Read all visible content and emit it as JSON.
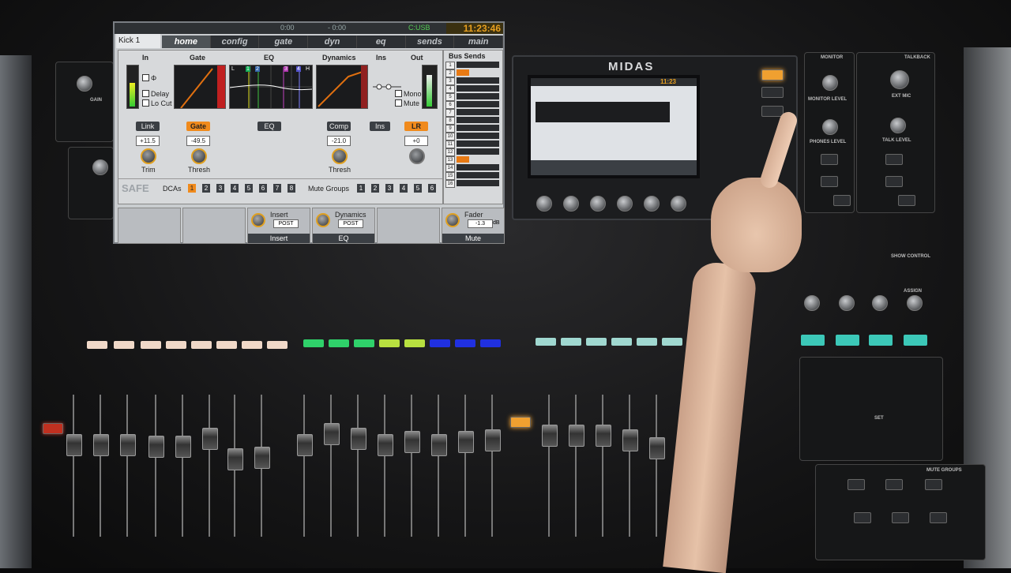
{
  "app": {
    "channel_name": "Kick 1",
    "time_elapsed": "0:00",
    "time_remaining": "- 0:00",
    "source": "C:USB",
    "clock": "11:23:46"
  },
  "tabs": [
    {
      "label": "home",
      "active": true
    },
    {
      "label": "config",
      "active": false
    },
    {
      "label": "gate",
      "active": false
    },
    {
      "label": "dyn",
      "active": false
    },
    {
      "label": "eq",
      "active": false
    },
    {
      "label": "sends",
      "active": false
    },
    {
      "label": "main",
      "active": false
    }
  ],
  "home": {
    "headers": {
      "in": "In",
      "gate": "Gate",
      "eq": "EQ",
      "dynamics": "Dynamics",
      "ins": "Ins",
      "out": "Out",
      "bus_sends": "Bus Sends"
    },
    "checkboxes": {
      "phase": "Φ",
      "delay": "Delay",
      "lo_cut": "Lo Cut",
      "mono": "Mono",
      "mute": "Mute"
    },
    "eq_bands": [
      "L",
      "1",
      "2",
      "3",
      "4",
      "H"
    ],
    "buttons": {
      "link": "Link",
      "gate": "Gate",
      "eq": "EQ",
      "comp": "Comp",
      "ins": "Ins",
      "lr": "LR"
    },
    "values": {
      "trim": "+11.5",
      "gate_thresh": "-49.5",
      "comp_thresh": "-21.0",
      "lr": "+0"
    },
    "knob_labels": {
      "trim": "Trim",
      "gate_thresh": "Thresh",
      "comp_thresh": "Thresh"
    },
    "safe": "SAFE",
    "dcas_label": "DCAs",
    "dcas": [
      "1",
      "2",
      "3",
      "4",
      "5",
      "6",
      "7",
      "8"
    ],
    "dca_active": "1",
    "mute_groups_label": "Mute Groups",
    "mute_groups": [
      "1",
      "2",
      "3",
      "4",
      "5",
      "6"
    ],
    "bus_sends": [
      "1",
      "2",
      "3",
      "4",
      "5",
      "6",
      "7",
      "8",
      "9",
      "10",
      "11",
      "12",
      "13",
      "14",
      "15",
      "16"
    ],
    "bus_active": [
      "2",
      "13"
    ]
  },
  "softkeys": {
    "insert": {
      "title": "Insert",
      "tag": "POST",
      "label": "Insert"
    },
    "dynamics": {
      "title": "Dynamics",
      "tag": "POST",
      "label": "EQ"
    },
    "fader": {
      "title": "Fader",
      "value": "-1.3",
      "unit": "dB",
      "label": "Mute"
    }
  },
  "console": {
    "brand": "MIDAS",
    "lcd_clock": "11:23",
    "monitor": {
      "title": "MONITOR",
      "monitor_level": "MONITOR LEVEL",
      "phones_level": "PHONES LEVEL"
    },
    "talkback": {
      "title": "TALKBACK",
      "ext_mic": "EXT MIC",
      "talk_level": "TALK LEVEL"
    },
    "show_control": "SHOW CONTROL",
    "assign": "ASSIGN",
    "set": "SET",
    "mute_groups": "MUTE GROUPS",
    "gain": "GAIN",
    "colors": {
      "accent": "#f08a1c",
      "scribble_green": "#2fd16a",
      "scribble_blue": "#2030e0",
      "scribble_cyan": "#40e0d0"
    }
  }
}
